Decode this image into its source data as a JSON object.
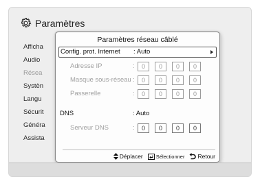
{
  "page": {
    "title": "Paramètres",
    "title_icon": "gear-icon"
  },
  "menu": [
    {
      "label": "Afficha"
    },
    {
      "label": "Audio"
    },
    {
      "label": "Résea"
    },
    {
      "label": "Systèn"
    },
    {
      "label": "Langu"
    },
    {
      "label": "Sécurit"
    },
    {
      "label": "Généra"
    },
    {
      "label": "Assista"
    }
  ],
  "dialog": {
    "title": "Paramètres réseau câblé",
    "config": {
      "label": "Config. prot. Internet",
      "value": ": Auto"
    },
    "ip": {
      "label": "Adresse IP",
      "colon": ":",
      "octets": [
        "0",
        "0",
        "0",
        "0"
      ]
    },
    "mask": {
      "label": "Masque sous-réseau",
      "colon": ":",
      "octets": [
        "0",
        "0",
        "0",
        "0"
      ]
    },
    "gateway": {
      "label": "Passerelle",
      "colon": ":",
      "octets": [
        "0",
        "0",
        "0",
        "0"
      ]
    },
    "dns": {
      "label": "DNS",
      "value": ": Auto"
    },
    "dns_server": {
      "label": "Serveur DNS",
      "colon": ":",
      "octets": [
        "0",
        "0",
        "0",
        "0"
      ]
    }
  },
  "footer": {
    "move": {
      "icon": "up-down-arrows-icon",
      "label": "Déplacer"
    },
    "select": {
      "icon": "enter-icon",
      "label": "Sélectionner"
    },
    "back": {
      "icon": "return-icon",
      "label": "Retour"
    }
  },
  "colors": {
    "background": "#eeeeee",
    "dialog": "#fdfdfd",
    "dim_text": "#a0a0a0",
    "text": "#111111"
  }
}
